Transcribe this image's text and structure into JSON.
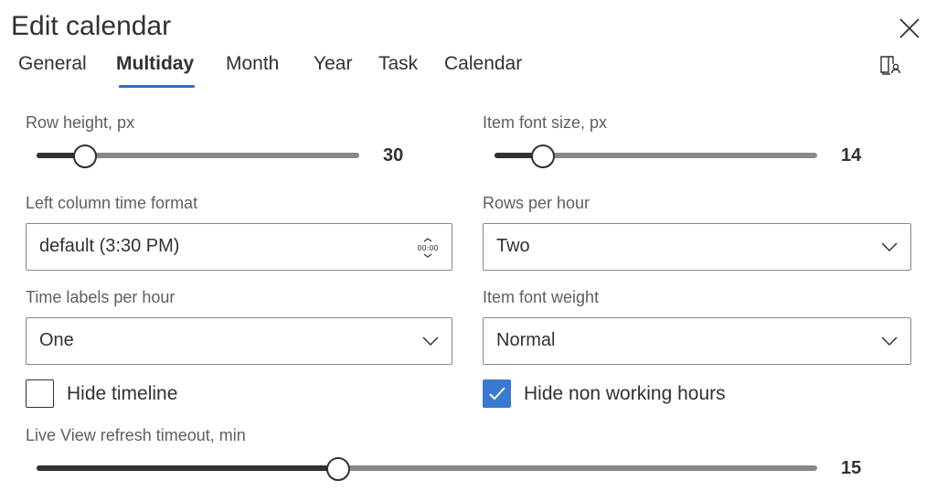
{
  "dialog": {
    "title": "Edit calendar",
    "close_icon": "close-icon",
    "help_icon": "book-user-icon"
  },
  "tabs": [
    {
      "label": "General",
      "active": false
    },
    {
      "label": "Multiday",
      "active": true
    },
    {
      "label": "Month",
      "active": false
    },
    {
      "label": "Year",
      "active": false
    },
    {
      "label": "Task",
      "active": false
    },
    {
      "label": "Calendar",
      "active": false
    }
  ],
  "row_height": {
    "label": "Row height, px",
    "value": "30",
    "fraction": 0.15
  },
  "item_font_size": {
    "label": "Item font size, px",
    "value": "14",
    "fraction": 0.15
  },
  "left_column_time_format": {
    "label": "Left column time format",
    "value": "default (3:30 PM)",
    "icon": "time-spinner-icon"
  },
  "rows_per_hour": {
    "label": "Rows per hour",
    "value": "Two"
  },
  "time_labels_per_hour": {
    "label": "Time labels per hour",
    "value": "One"
  },
  "item_font_weight": {
    "label": "Item font weight",
    "value": "Normal"
  },
  "hide_timeline": {
    "label": "Hide timeline",
    "checked": false
  },
  "hide_non_working_hours": {
    "label": "Hide non working hours",
    "checked": true
  },
  "live_view_refresh": {
    "label": "Live View refresh timeout, min",
    "value": "15",
    "fraction": 0.386
  },
  "colors": {
    "accent": "#3b78d0",
    "tab_underline": "#2f6fc1",
    "text": "#323130",
    "muted": "#605e5c"
  }
}
